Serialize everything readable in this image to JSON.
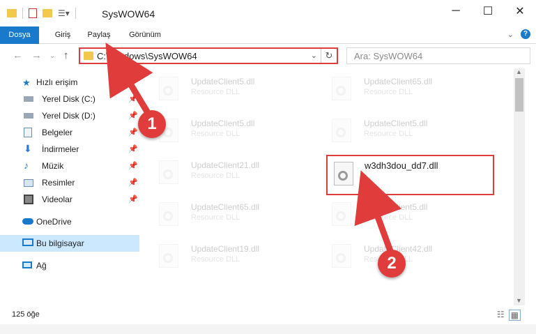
{
  "window": {
    "title": "SysWOW64",
    "controls": [
      "─",
      "☐",
      "✕"
    ]
  },
  "ribbon": {
    "tabs": [
      "Dosya",
      "Giriş",
      "Paylaş",
      "Görünüm"
    ],
    "help_label": "?"
  },
  "navigation": {
    "address_path": "C:\\Windows\\SysWOW64",
    "search_placeholder": "Ara: SysWOW64"
  },
  "sidebar": {
    "quick_access": "Hızlı erişim",
    "items": [
      {
        "label": "Yerel Disk (C:)",
        "icon": "drive-icon"
      },
      {
        "label": "Yerel Disk (D:)",
        "icon": "drive-icon"
      },
      {
        "label": "Belgeler",
        "icon": "documents-icon"
      },
      {
        "label": "İndirmeler",
        "icon": "downloads-icon"
      },
      {
        "label": "Müzik",
        "icon": "music-icon"
      },
      {
        "label": "Resimler",
        "icon": "pictures-icon"
      },
      {
        "label": "Videolar",
        "icon": "videos-icon"
      }
    ],
    "onedrive": "OneDrive",
    "this_pc": "Bu bilgisayar",
    "network": "Ağ"
  },
  "files": {
    "left_column": [
      {
        "name": "UpdateClient5.dll",
        "type": "Resource DLL"
      },
      {
        "name": "UpdateClient5.dll",
        "type": "Resource DLL"
      },
      {
        "name": "UpdateClient21.dll",
        "type": "Resource DLL"
      },
      {
        "name": "UpdateClient65.dll",
        "type": "Resource DLL"
      },
      {
        "name": "UpdateClient19.dll",
        "type": "Resource DLL"
      }
    ],
    "right_column": [
      {
        "name": "UpdateClient65.dll",
        "type": "Resource DLL"
      },
      {
        "name": "UpdateClient5.dll",
        "type": "Resource DLL"
      },
      {
        "name": "UpdateClient5.dll",
        "type": "Resource DLL"
      },
      {
        "name": "UpdateClient42.dll",
        "type": "Resource DLL"
      }
    ],
    "highlighted": {
      "name": "w3dh3dou_dd7.dll"
    }
  },
  "status": {
    "item_count": "125 öğe"
  },
  "annotations": {
    "step1": "1",
    "step2": "2"
  },
  "colors": {
    "accent": "#1979ca",
    "highlight": "#e03c3c",
    "selection": "#cce8ff"
  }
}
